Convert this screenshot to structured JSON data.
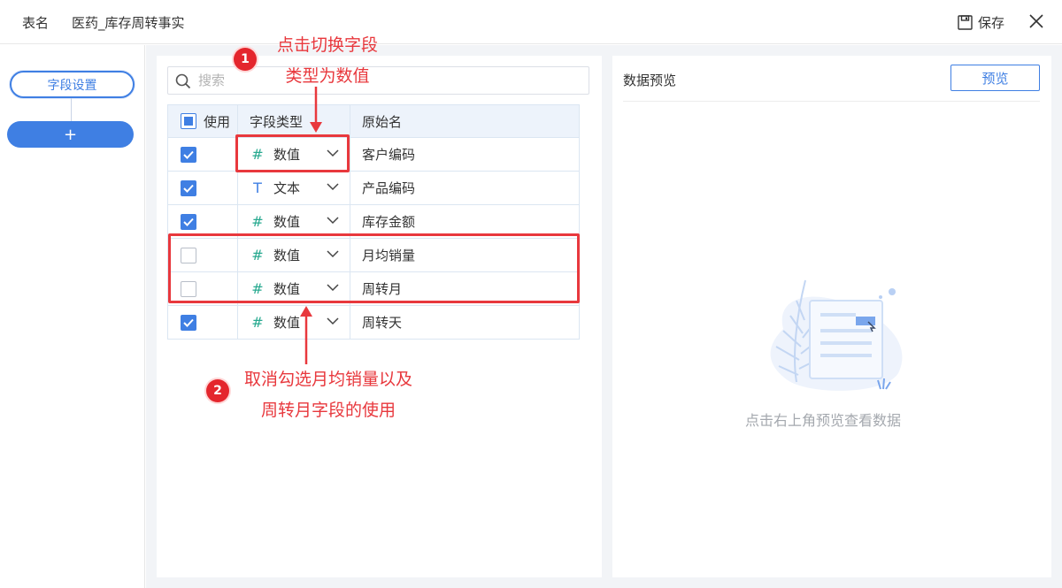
{
  "header": {
    "table_name_label": "表名",
    "table_name_value": "医药_库存周转事实",
    "save_label": "保存"
  },
  "left": {
    "step_label": "字段设置",
    "add_label": "+"
  },
  "fields": {
    "search_placeholder": "搜索",
    "columns": [
      "使用",
      "字段类型",
      "原始名"
    ],
    "rows": [
      {
        "checked": true,
        "type_icon": "#",
        "type": "数值",
        "name": "客户编码"
      },
      {
        "checked": true,
        "type_icon": "T",
        "type": "文本",
        "name": "产品编码"
      },
      {
        "checked": true,
        "type_icon": "#",
        "type": "数值",
        "name": "库存金额"
      },
      {
        "checked": false,
        "type_icon": "#",
        "type": "数值",
        "name": "月均销量"
      },
      {
        "checked": false,
        "type_icon": "#",
        "type": "数值",
        "name": "周转月"
      },
      {
        "checked": true,
        "type_icon": "#",
        "type": "数值",
        "name": "周转天"
      }
    ]
  },
  "preview": {
    "title": "数据预览",
    "button_label": "预览",
    "empty_text": "点击右上角预览查看数据"
  },
  "annotations": {
    "badge1": "1",
    "note1_line1": "点击切换字段",
    "note1_line2": "类型为数值",
    "badge2": "2",
    "note2_line1": "取消勾选月均销量以及",
    "note2_line2": "周转月字段的使用"
  },
  "colors": {
    "accent": "#3f7fe3",
    "annotation": "#e8383d",
    "number_icon": "#27a98f"
  }
}
